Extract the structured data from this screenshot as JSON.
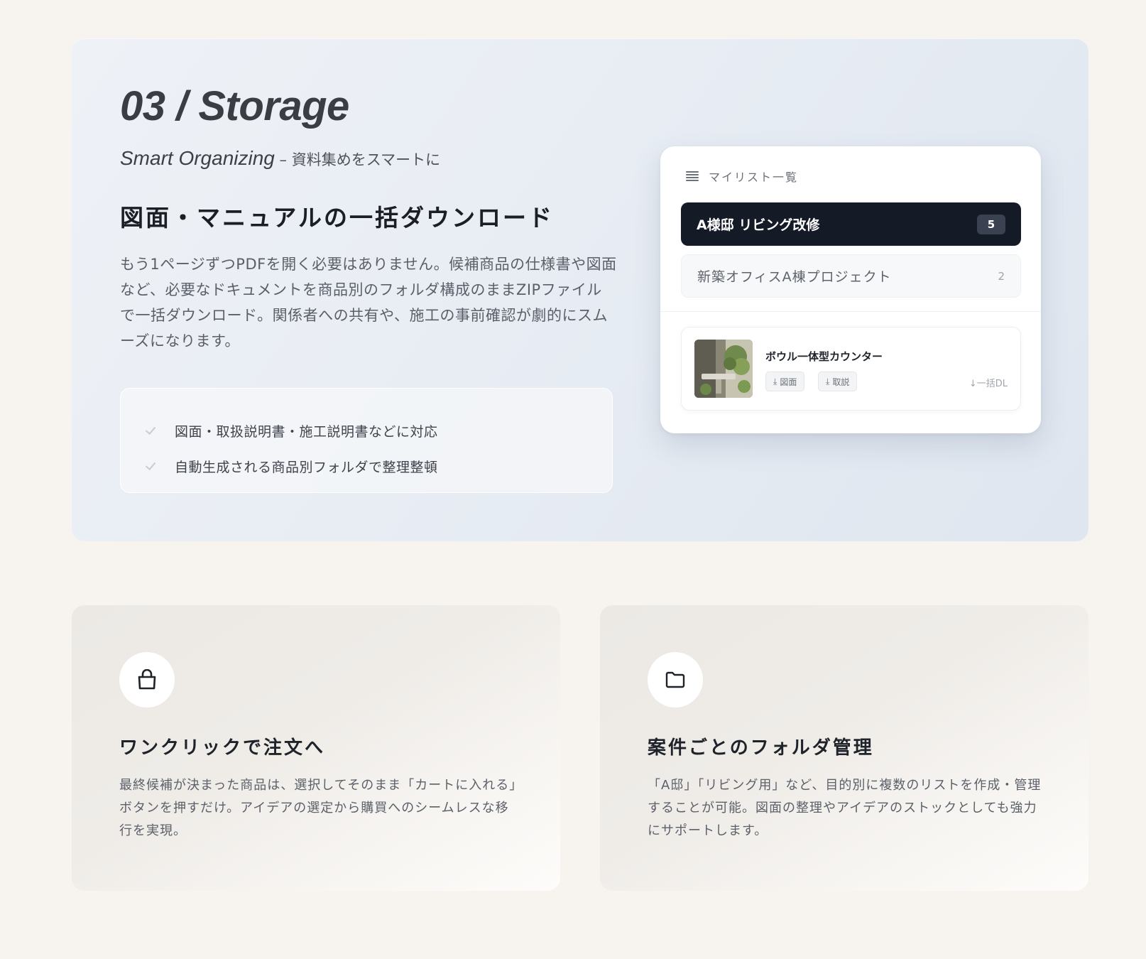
{
  "hero": {
    "title": "03 / Storage",
    "subtitle_en": "Smart Organizing",
    "subtitle_sep": " – ",
    "subtitle_ja": "資料集めをスマートに",
    "heading": "図面・マニュアルの一括ダウンロード",
    "description": "もう1ページずつPDFを開く必要はありません。候補商品の仕様書や図面など、必要なドキュメントを商品別のフォルダ構成のままZIPファイルで一括ダウンロード。関係者への共有や、施工の事前確認が劇的にスムーズになります。",
    "features": [
      "図面・取扱説明書・施工説明書などに対応",
      "自動生成される商品別フォルダで整理整頓"
    ]
  },
  "mock": {
    "header_label": "マイリスト一覧",
    "lists": [
      {
        "label": "A様邸 リビング改修",
        "count": "5",
        "active": true
      },
      {
        "label": "新築オフィスA棟プロジェクト",
        "count": "2",
        "active": false
      }
    ],
    "product": {
      "name": "ボウル一体型カウンター",
      "tags": [
        "図面",
        "取説"
      ],
      "bulk_dl": "↓一括DL"
    }
  },
  "cards": [
    {
      "icon": "shopping-bag-icon",
      "title": "ワンクリックで注文へ",
      "description": "最終候補が決まった商品は、選択してそのまま「カートに入れる」ボタンを押すだけ。アイデアの選定から購買へのシームレスな移行を実現。"
    },
    {
      "icon": "folder-icon",
      "title": "案件ごとのフォルダ管理",
      "description": "「A邸」「リビング用」など、目的別に複数のリストを作成・管理することが可能。図面の整理やアイデアのストックとしても強力にサポートします。"
    }
  ],
  "colors": {
    "page_bg": "#f7f3ee",
    "hero_bg": "#e8edf4",
    "active_list_bg": "#141a26"
  }
}
